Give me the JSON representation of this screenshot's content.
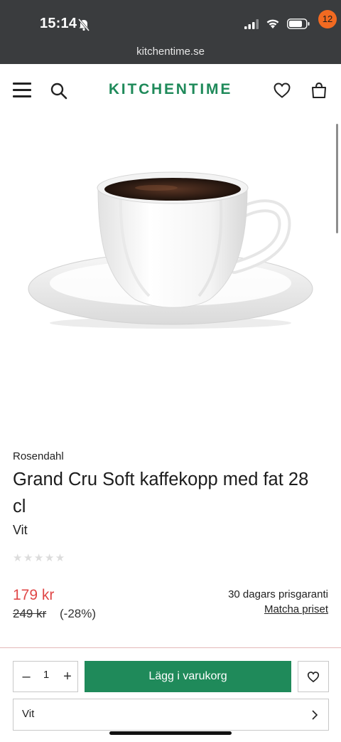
{
  "status": {
    "time": "15:14"
  },
  "browser": {
    "url": "kitchentime.se"
  },
  "header": {
    "logo": "KITCHENTIME",
    "cart_count": "12"
  },
  "product": {
    "brand": "Rosendahl",
    "title": "Grand Cru Soft kaffekopp med fat 28 cl",
    "variant": "Vit",
    "rating": {
      "stars_filled": 0,
      "stars_total": 5,
      "glyphs": "★★★★★"
    },
    "price": "179 kr",
    "old_price": "249 kr",
    "discount": "(-28%)",
    "guarantee": "30 dagars prisgaranti",
    "match_link": "Matcha priset"
  },
  "purchase": {
    "qty_minus": "–",
    "qty": "1",
    "qty_plus": "+",
    "add_to_cart": "Lägg i varukorg",
    "option_value": "Vit"
  },
  "colors": {
    "brand_green": "#1f8a5a",
    "sale_red": "#e04848",
    "badge_orange": "#f26a21",
    "statusbar": "#3a3c3e"
  }
}
